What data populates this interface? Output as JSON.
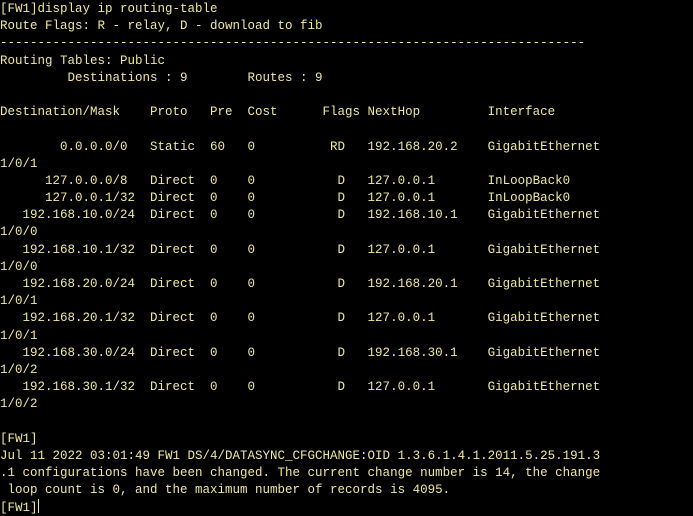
{
  "terminal": {
    "text_color": "#f0e6a0",
    "background": "#000000",
    "lines": [
      "[FW1]display ip routing-table",
      "Route Flags: R - relay, D - download to fib",
      "------------------------------------------------------------------------------",
      "Routing Tables: Public",
      "         Destinations : 9        Routes : 9",
      "",
      "Destination/Mask    Proto   Pre  Cost      Flags NextHop         Interface",
      "",
      "        0.0.0.0/0   Static  60   0          RD   192.168.20.2    GigabitEthernet",
      "1/0/1",
      "      127.0.0.0/8   Direct  0    0           D   127.0.0.1       InLoopBack0",
      "      127.0.0.1/32  Direct  0    0           D   127.0.0.1       InLoopBack0",
      "   192.168.10.0/24  Direct  0    0           D   192.168.10.1    GigabitEthernet",
      "1/0/0",
      "   192.168.10.1/32  Direct  0    0           D   127.0.0.1       GigabitEthernet",
      "1/0/0",
      "   192.168.20.0/24  Direct  0    0           D   192.168.20.1    GigabitEthernet",
      "1/0/1",
      "   192.168.20.1/32  Direct  0    0           D   127.0.0.1       GigabitEthernet",
      "1/0/1",
      "   192.168.30.0/24  Direct  0    0           D   192.168.30.1    GigabitEthernet",
      "1/0/2",
      "   192.168.30.1/32  Direct  0    0           D   127.0.0.1       GigabitEthernet",
      "1/0/2",
      "",
      "[FW1]",
      "Jul 11 2022 03:01:49 FW1 DS/4/DATASYNC_CFGCHANGE:OID 1.3.6.1.4.1.2011.5.25.191.3",
      ".1 configurations have been changed. The current change number is 14, the change",
      " loop count is 0, and the maximum number of records is 4095."
    ],
    "prompt": "[FW1]"
  }
}
